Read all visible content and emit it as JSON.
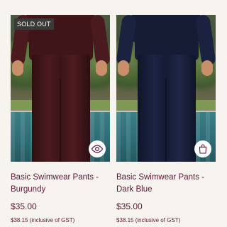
{
  "products": [
    {
      "title": "Basic Swimwear Pants - Burgundy",
      "price": "$35.00",
      "price_note": "$38.15 (inclusive of GST)",
      "badge": "SOLD OUT",
      "action_icon": "eye-icon",
      "pants_color": "#3f1519"
    },
    {
      "title": "Basic Swimwear Pants - Dark Blue",
      "price": "$35.00",
      "price_note": "$38.15 (inclusive of GST)",
      "action_icon": "shopping-bag-icon",
      "pants_color": "#161c33"
    }
  ],
  "colors": {
    "text": "#5e1938",
    "background": "#f7f4ef",
    "badge_bg": "#3a3a38"
  }
}
